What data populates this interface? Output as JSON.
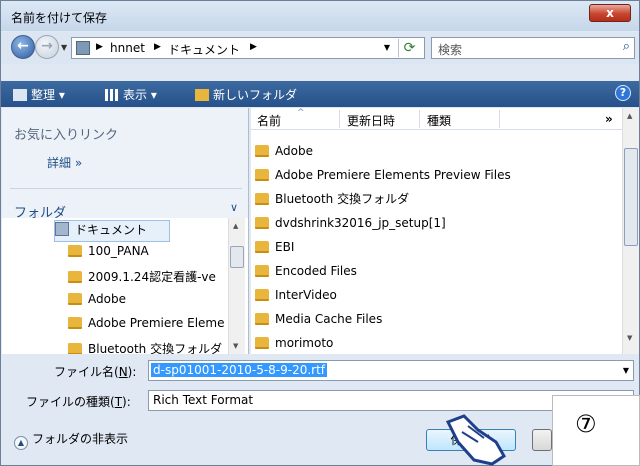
{
  "window": {
    "title": "名前を付けて保存",
    "close_label": "x"
  },
  "address": {
    "crumbs": [
      "hnnet",
      "ドキュメント"
    ],
    "search_placeholder": "検索"
  },
  "toolbar": {
    "organize": "整理 ▾",
    "view": "表示 ▾",
    "new_folder": "新しいフォルダ",
    "help": "?"
  },
  "left_panel": {
    "favorites_heading": "お気に入りリンク",
    "details_link": "詳細 »",
    "folders_heading": "フォルダ",
    "tree": [
      "ドキュメント",
      "100_PANA",
      "2009.1.24認定看護-ve",
      "Adobe",
      "Adobe Premiere Eleme",
      "Bluetooth 交換フォルダ"
    ]
  },
  "file_list": {
    "columns": [
      "名前",
      "更新日時",
      "種類"
    ],
    "more": "»",
    "files": [
      "Adobe",
      "Adobe Premiere Elements Preview Files",
      "Bluetooth 交換フォルダ",
      "dvdshrink32016_jp_setup[1]",
      "EBI",
      "Encoded Files",
      "InterVideo",
      "Media Cache Files",
      "morimoto"
    ]
  },
  "form": {
    "filename_label_pre": "ファイル名(",
    "filename_label_key": "N",
    "filename_label_post": "):",
    "filename_value": "d-sp01001-2010-5-8-9-20.rtf",
    "filetype_label_pre": "ファイルの種類(",
    "filetype_label_key": "T",
    "filetype_label_post": "):",
    "filetype_value": "Rich Text Format",
    "hide_folders": "フォルダの非表示",
    "save_button": "保存(S)"
  },
  "overlay": {
    "step": "⑦",
    "bracket": "「"
  },
  "colors": {
    "toolbar": "#26518a",
    "selection": "#3399ff",
    "folder": "#e8b53d"
  }
}
